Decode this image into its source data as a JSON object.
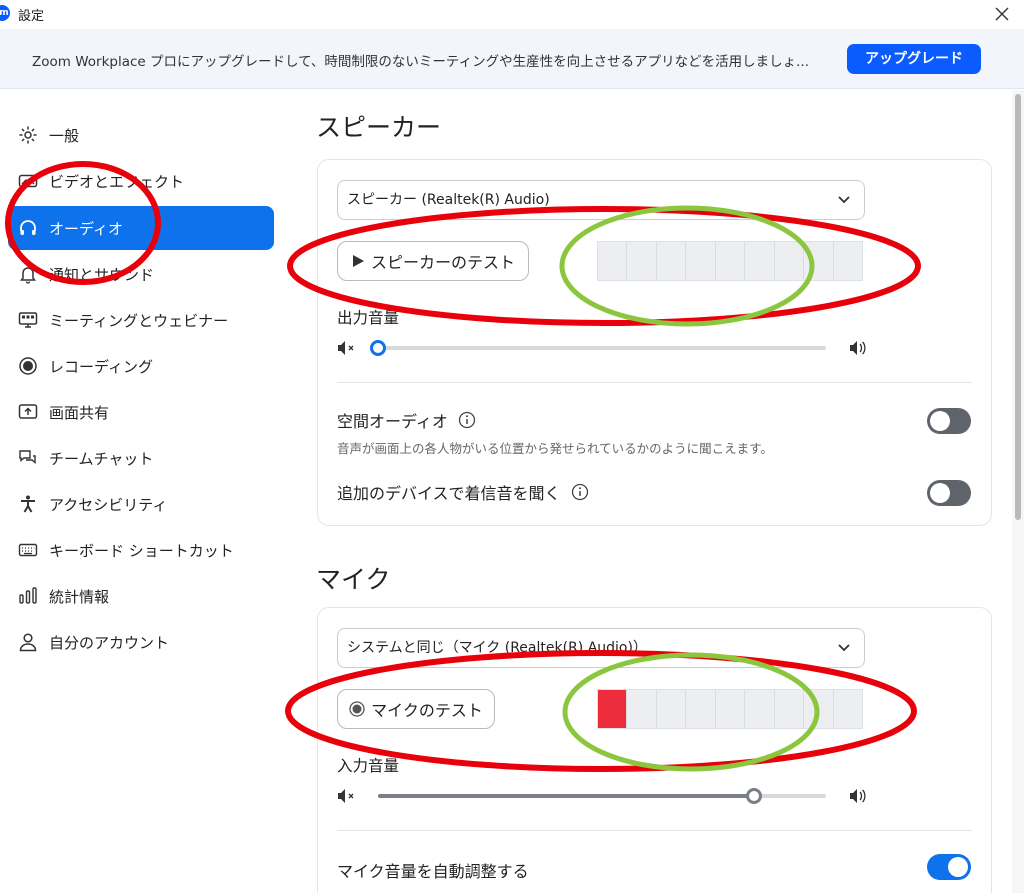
{
  "window": {
    "title": "設定",
    "app_logo": "zm"
  },
  "banner": {
    "text": "Zoom Workplace プロにアップグレードして、時間制限のないミーティングや生産性を向上させるアプリなどを活用しましょ...",
    "upgrade_label": "アップグレード"
  },
  "sidebar": {
    "items": [
      {
        "label": "一般",
        "icon": "gear-icon"
      },
      {
        "label": "ビデオとエフェクト",
        "icon": "video-icon"
      },
      {
        "label": "オーディオ",
        "icon": "headphones-icon",
        "active": true
      },
      {
        "label": "通知とサウンド",
        "icon": "bell-icon"
      },
      {
        "label": "ミーティングとウェビナー",
        "icon": "meeting-icon"
      },
      {
        "label": "レコーディング",
        "icon": "record-icon"
      },
      {
        "label": "画面共有",
        "icon": "share-screen-icon"
      },
      {
        "label": "チームチャット",
        "icon": "chat-icon"
      },
      {
        "label": "アクセシビリティ",
        "icon": "accessibility-icon"
      },
      {
        "label": "キーボード ショートカット",
        "icon": "keyboard-icon"
      },
      {
        "label": "統計情報",
        "icon": "stats-icon"
      },
      {
        "label": "自分のアカウント",
        "icon": "account-icon"
      }
    ]
  },
  "speaker": {
    "title": "スピーカー",
    "device": "スピーカー (Realtek(R) Audio)",
    "test_label": "スピーカーのテスト",
    "meter_level": 0,
    "volume_label": "出力音量",
    "volume": 0,
    "spatial_label": "空間オーディオ",
    "spatial_desc": "音声が画面上の各人物がいる位置から発せられているかのように聞こえます。",
    "spatial_on": false,
    "ring_label": "追加のデバイスで着信音を聞く",
    "ring_on": false
  },
  "mic": {
    "title": "マイク",
    "device": "システムと同じ（マイク (Realtek(R) Audio)）",
    "test_label": "マイクのテスト",
    "meter_level": 1,
    "volume_label": "入力音量",
    "volume": 0.84,
    "auto_label": "マイク音量を自動調整する",
    "auto_on": true
  },
  "annotations": {
    "red": "#e8000b",
    "green": "#8cc63f"
  },
  "colors": {
    "accent": "#0e72ed",
    "brand": "#0b5cff",
    "meter_lit": "#ee2d3c"
  }
}
